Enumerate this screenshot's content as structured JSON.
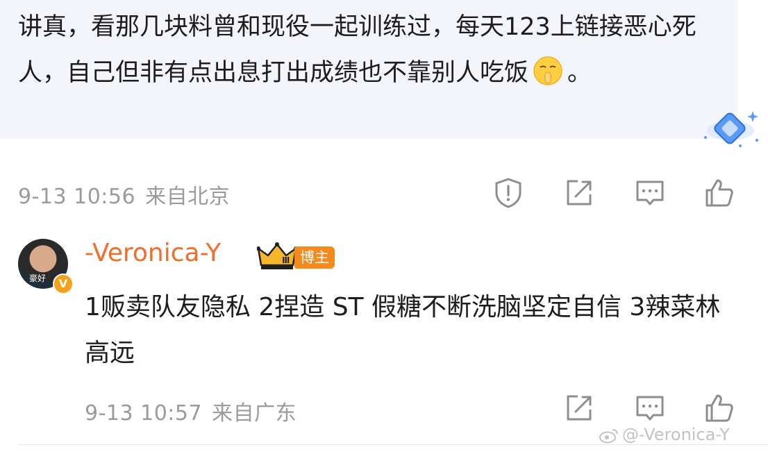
{
  "comment": {
    "text_part1": "讲真，看那几块料曾和现役一起训练过，每天123上链接恶心死人，自己但非有点出息打出成绩也不靠别人吃饭",
    "emoji": "shushing-face-emoji",
    "text_part2": "。",
    "date": "9-13 10:56",
    "location": "来自北京"
  },
  "reply": {
    "username": "-Veronica-Y",
    "avatar_label": "豪好",
    "verified_mark": "V",
    "author_badge": "博主",
    "crown_level": "Ⅲ",
    "text": "1贩卖队友隐私 2捏造 ST 假糖不断洗脑坚定自信 3辣菜林高远",
    "date": "9-13 10:57",
    "location": "来自广东"
  },
  "watermark": "@-Veronica-Y",
  "icons": [
    "report-icon",
    "share-icon",
    "comment-icon",
    "like-icon"
  ],
  "colors": {
    "username": "#f26d2a",
    "badge": "#f58a1f",
    "meta": "#9b9b9b",
    "bubble": "#f4f5fa"
  }
}
